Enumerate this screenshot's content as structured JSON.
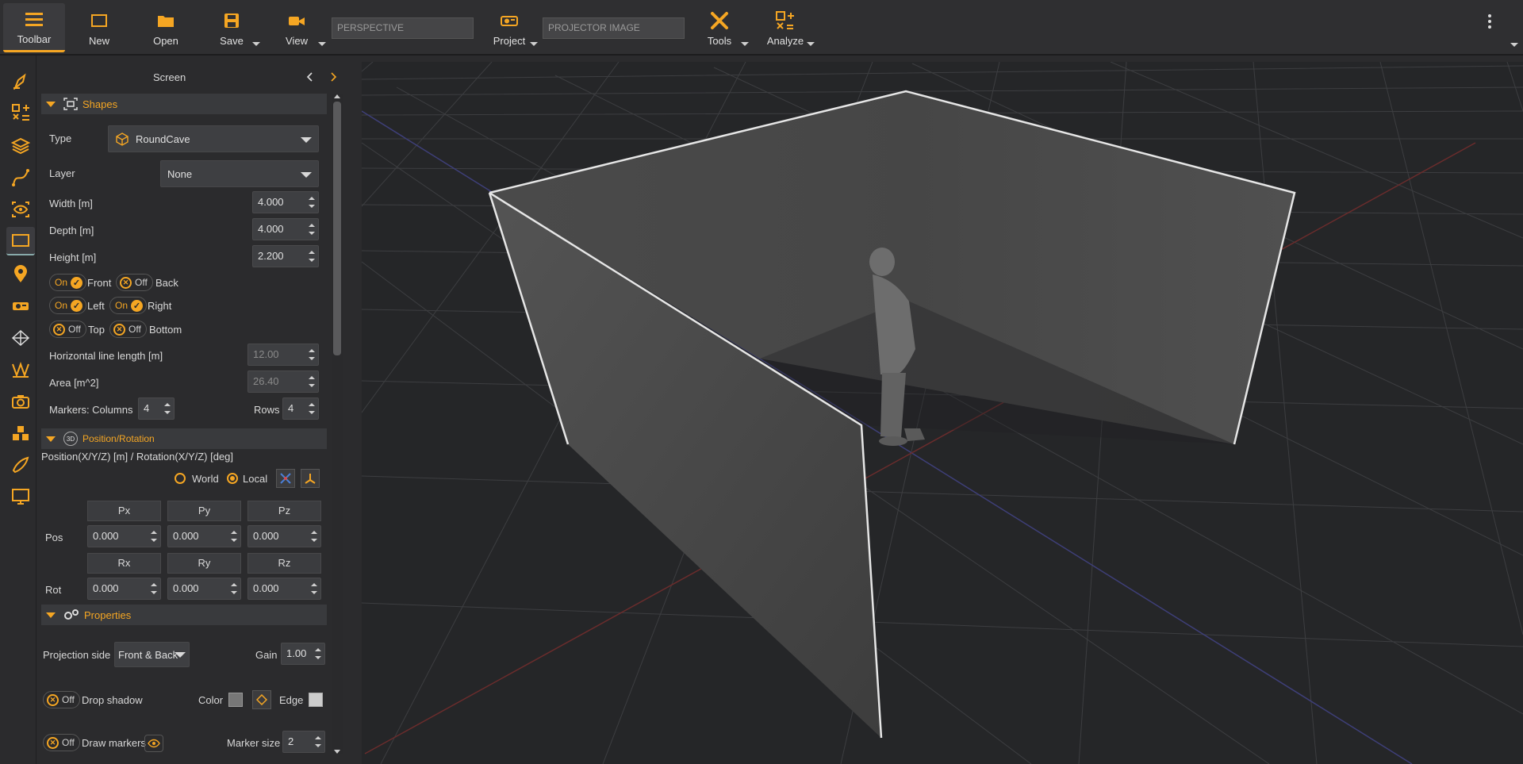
{
  "toolbar": {
    "toolbar_label": "Toolbar",
    "new_label": "New",
    "open_label": "Open",
    "save_label": "Save",
    "view_label": "View",
    "perspective_field": "PERSPECTIVE",
    "project_label": "Project",
    "projector_field": "PROJECTOR IMAGE",
    "tools_label": "Tools",
    "analyze_label": "Analyze"
  },
  "panel": {
    "title": "Screen",
    "shapes": {
      "title": "Shapes",
      "type_label": "Type",
      "type_value": "RoundCave",
      "layer_label": "Layer",
      "layer_value": "None",
      "width_label": "Width  [m]",
      "width_value": "4.000",
      "depth_label": "Depth  [m]",
      "depth_value": "4.000",
      "height_label": "Height  [m]",
      "height_value": "2.200",
      "on": "On",
      "off": "Off",
      "front": "Front",
      "back": "Back",
      "left": "Left",
      "right": "Right",
      "top": "Top",
      "bottom": "Bottom",
      "hline_label": "Horizontal line length  [m]",
      "hline_value": "12.00",
      "area_label": "Area  [m^2]",
      "area_value": "26.40",
      "markers_label": "Markers:  Columns",
      "columns_value": "4",
      "rows_label": "Rows",
      "rows_value": "4"
    },
    "position": {
      "title": "Position/Rotation",
      "badge": "3D",
      "subtitle": "Position(X/Y/Z) [m] / Rotation(X/Y/Z) [deg]",
      "world": "World",
      "local": "Local",
      "px": "Px",
      "py": "Py",
      "pz": "Pz",
      "rx": "Rx",
      "ry": "Ry",
      "rz": "Rz",
      "pos_label": "Pos",
      "rot_label": "Rot",
      "pos_x": "0.000",
      "pos_y": "0.000",
      "pos_z": "0.000",
      "rot_x": "0.000",
      "rot_y": "0.000",
      "rot_z": "0.000"
    },
    "properties": {
      "title": "Properties",
      "projection_label": "Projection side",
      "projection_value": "Front & Back",
      "gain_label": "Gain",
      "gain_value": "1.00",
      "off": "Off",
      "drop_shadow": "Drop shadow",
      "color_label": "Color",
      "edge_label": "Edge",
      "draw_markers": "Draw markers",
      "marker_size_label": "Marker size",
      "marker_size_value": "2"
    }
  },
  "colors": {
    "accent": "#f5a623",
    "wall": "#4a4a4a",
    "viewport_bg": "#252628"
  }
}
